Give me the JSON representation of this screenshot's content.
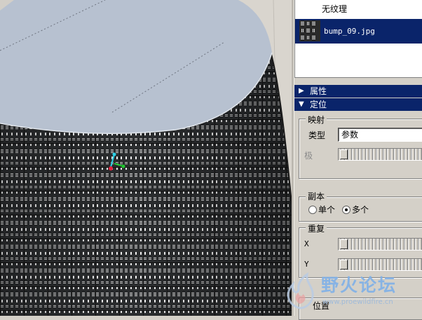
{
  "texture_list": {
    "no_texture_label": "无纹理",
    "selected_file": "bump_09.jpg"
  },
  "sections": {
    "attributes_label": "属性",
    "positioning_label": "定位"
  },
  "mapping": {
    "group_title": "映射",
    "type_label": "类型",
    "type_value": "参数",
    "pole_label": "极"
  },
  "copies": {
    "group_title": "副本",
    "single_label": "单个",
    "multiple_label": "多个",
    "selected": "多个"
  },
  "repeat": {
    "group_title": "重复",
    "x_label": "X",
    "y_label": "Y"
  },
  "position": {
    "label": "位置"
  },
  "watermark": {
    "title": "野火论坛",
    "url": "www.proewildfire.cn"
  },
  "colors": {
    "selection": "#0a246a",
    "panel": "#d4d0c8",
    "cylinder_top": "#b7c1d0",
    "cylinder_side": "#2b2d2f",
    "axis_x": "#e0203c",
    "axis_y": "#22c832",
    "axis_z": "#2ad0e6"
  }
}
